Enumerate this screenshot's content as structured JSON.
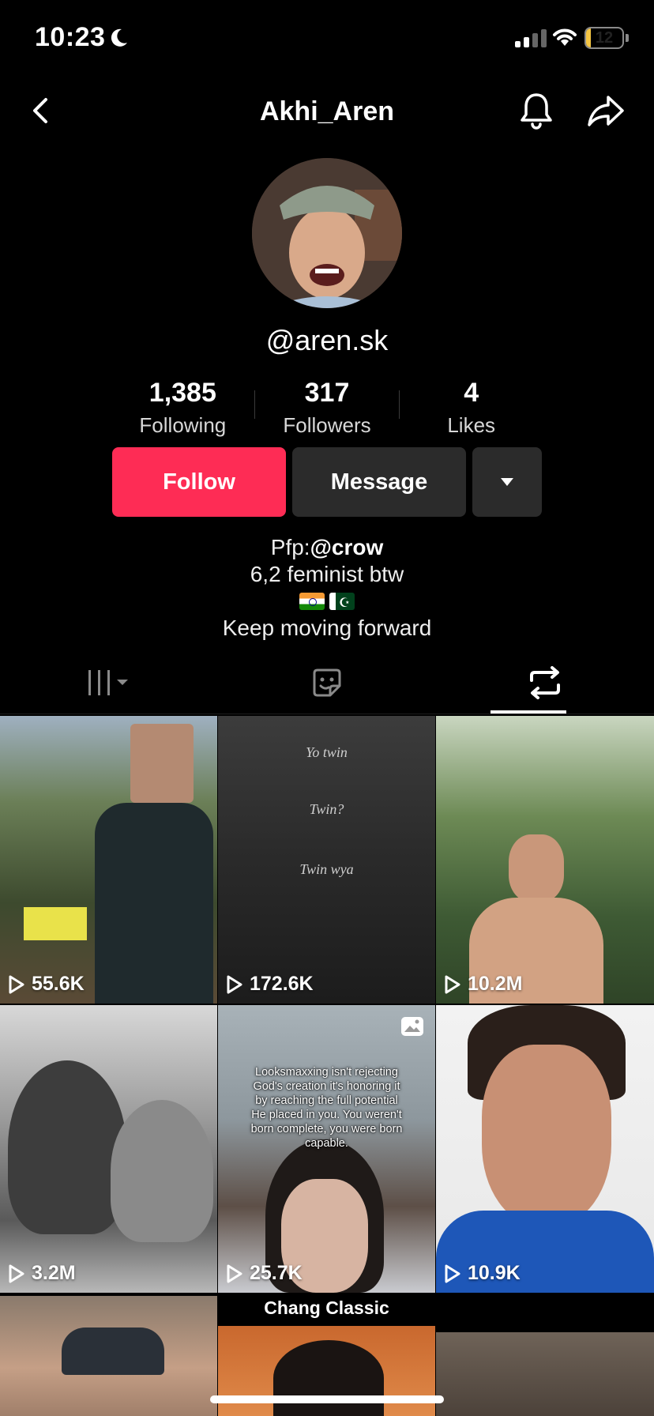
{
  "status": {
    "time": "10:23",
    "battery": "12",
    "battery_level": 0.12
  },
  "nav": {
    "title": "Akhi_Aren"
  },
  "profile": {
    "handle": "@aren.sk",
    "stats": [
      {
        "value": "1,385",
        "label": "Following"
      },
      {
        "value": "317",
        "label": "Followers"
      },
      {
        "value": "4",
        "label": "Likes"
      }
    ],
    "follow_label": "Follow",
    "message_label": "Message",
    "bio_prefix": "Pfp:",
    "bio_mention": "@crow",
    "bio_line2": "6,2 feminist btw",
    "bio_line4": "Keep moving forward"
  },
  "colors": {
    "accent": "#fe2c55",
    "background": "#000000",
    "button_dark": "#2b2b2b"
  },
  "tabs": [
    {
      "icon": "videos-grid-icon",
      "active": false
    },
    {
      "icon": "favorites-sticker-icon",
      "active": false
    },
    {
      "icon": "reposts-icon",
      "active": true
    }
  ],
  "videos": [
    {
      "views": "55.6K"
    },
    {
      "views": "172.6K",
      "overlay": [
        "Yo twin",
        "Twin?",
        "Twin wya"
      ]
    },
    {
      "views": "10.2M"
    },
    {
      "views": "3.2M"
    },
    {
      "views": "25.7K",
      "caption": "Looksmaxxing isn't rejecting God's creation it's honoring it by reaching the full potential He placed in you. You weren't born complete, you were born capable."
    },
    {
      "views": "10.9K"
    }
  ],
  "row3": {
    "label": "Chang Classic"
  }
}
